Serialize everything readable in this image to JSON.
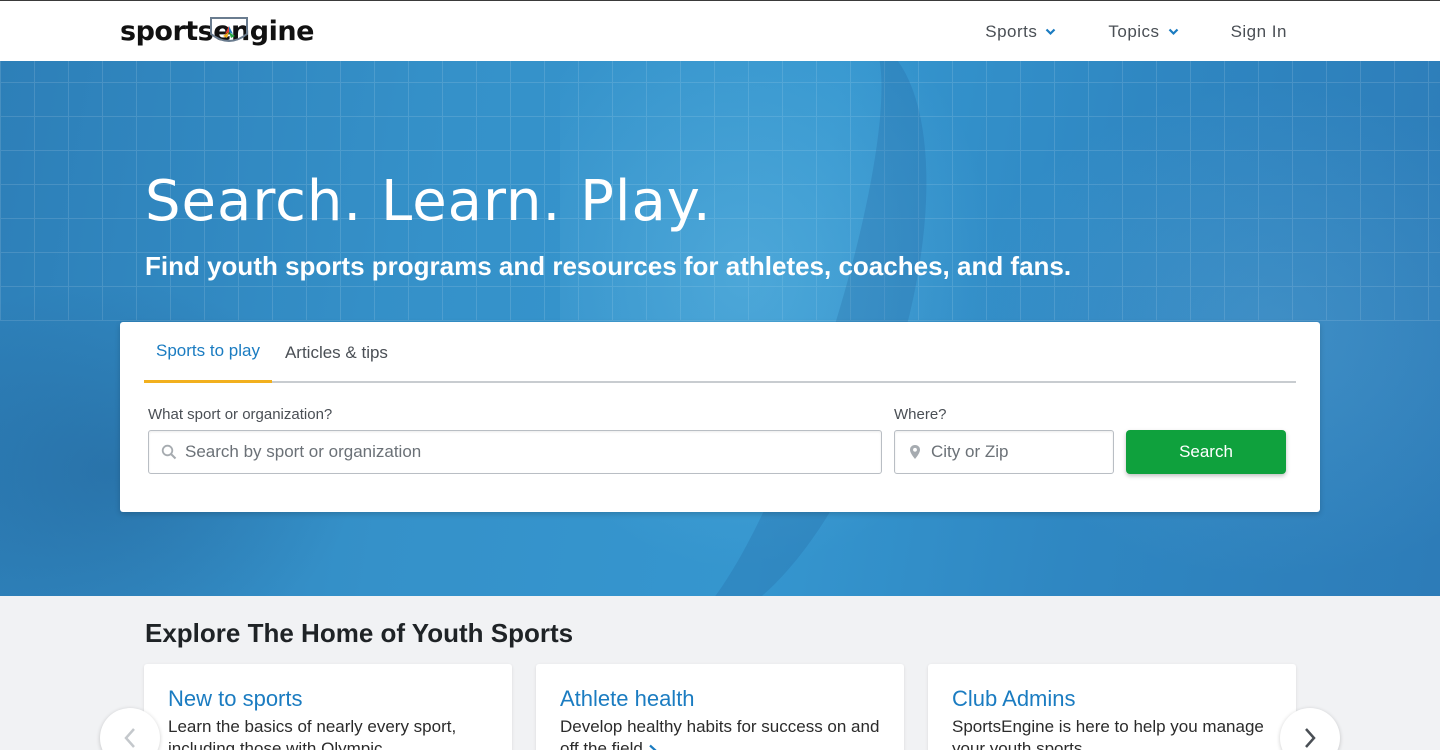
{
  "header": {
    "logo_text": "sportsengine",
    "nav": [
      {
        "label": "Sports",
        "icon": "chevron-down-icon"
      },
      {
        "label": "Topics",
        "icon": "chevron-down-icon"
      },
      {
        "label": "Sign In"
      }
    ]
  },
  "hero": {
    "title": "Search. Learn. Play.",
    "subtitle": "Find youth sports programs and resources for athletes, coaches, and fans."
  },
  "search": {
    "tabs": [
      {
        "label": "Sports to play",
        "active": true
      },
      {
        "label": "Articles & tips",
        "active": false
      }
    ],
    "sport_label": "What sport or organization?",
    "sport_placeholder": "Search by sport or organization",
    "where_label": "Where?",
    "where_placeholder": "City or Zip",
    "button_label": "Search"
  },
  "explore": {
    "title": "Explore The Home of Youth Sports",
    "tiles": [
      {
        "title": "New to sports",
        "text": "Learn the basics of nearly every sport, including those with Olympic"
      },
      {
        "title": "Athlete health",
        "text": "Develop healthy habits for success on and off the field"
      },
      {
        "title": "Club Admins",
        "text": "SportsEngine is here to help you manage your youth sports"
      }
    ]
  },
  "colors": {
    "accent_blue": "#1b7cc1",
    "tab_underline": "#f2b01e",
    "search_green": "#0fa13d",
    "hero_blue": "#3591c9"
  }
}
